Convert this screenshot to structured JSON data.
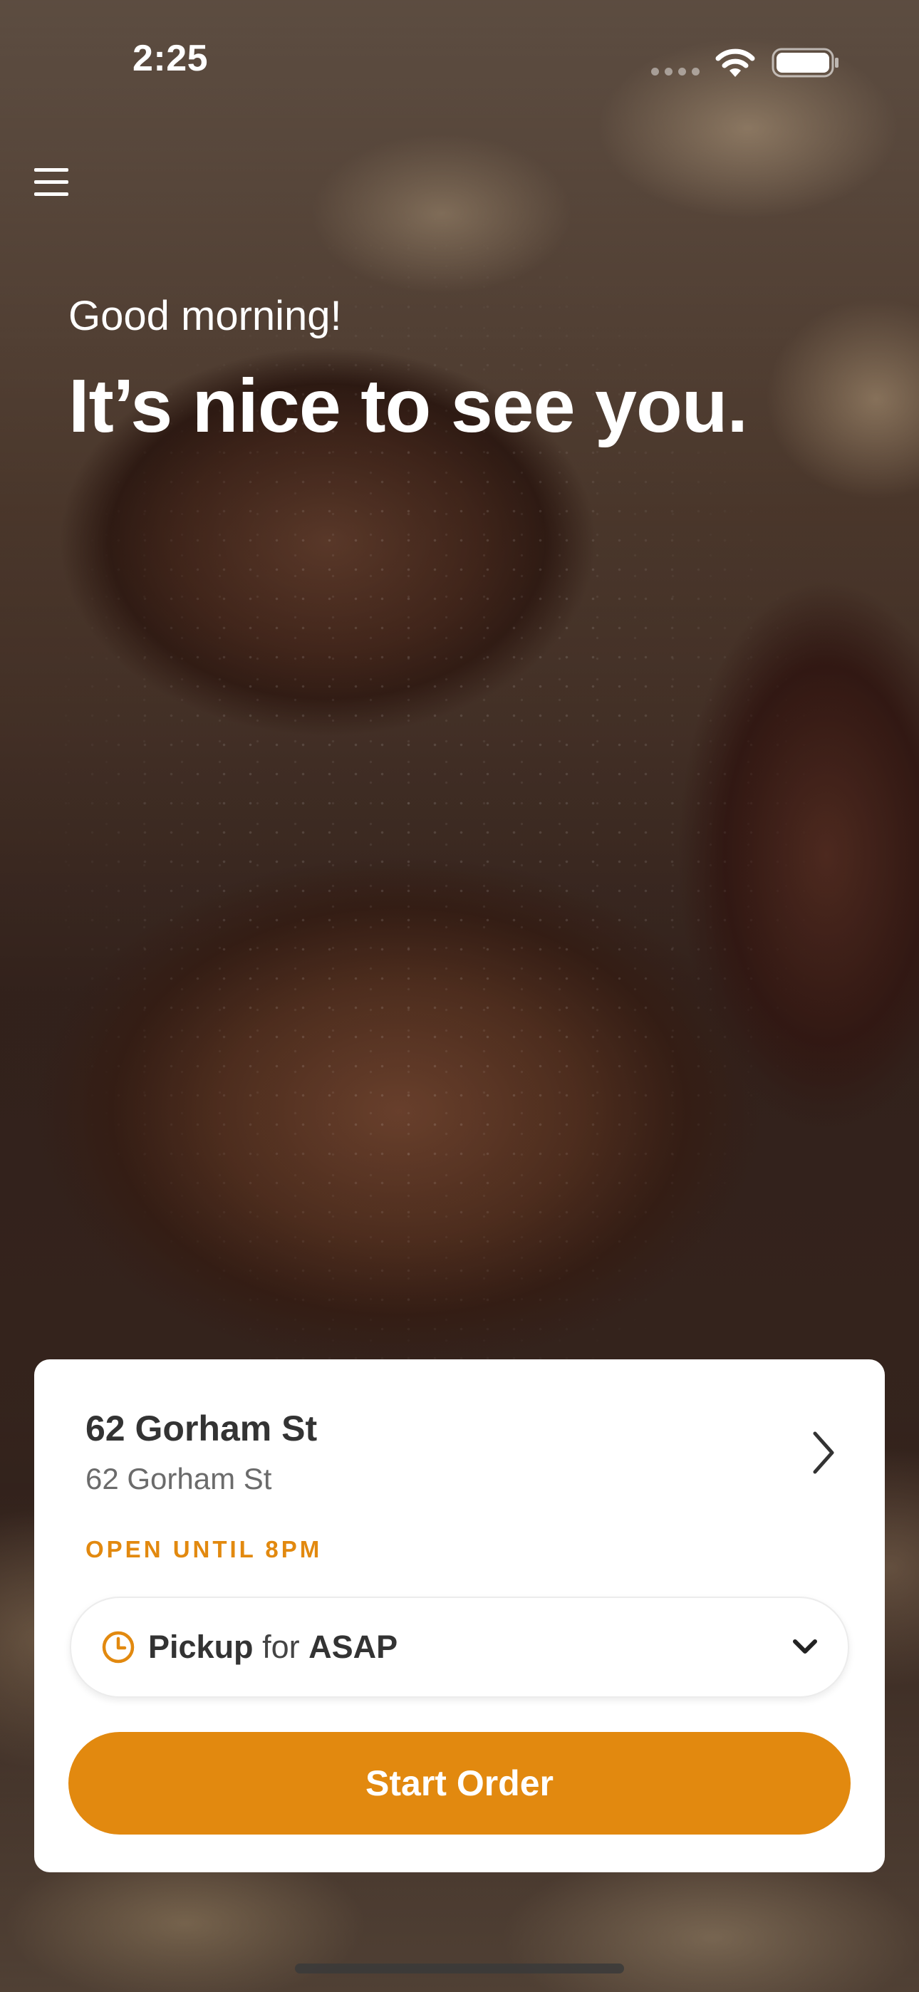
{
  "status_bar": {
    "time": "2:25"
  },
  "greeting": {
    "salutation": "Good morning!",
    "headline": "It’s nice to see you."
  },
  "location": {
    "name": "62 Gorham St",
    "address": "62 Gorham St",
    "hours": "OPEN UNTIL 8PM"
  },
  "order_mode": {
    "type": "Pickup",
    "connector": "for",
    "time": "ASAP"
  },
  "start_button": {
    "label": "Start Order"
  },
  "colors": {
    "accent": "#e2890f",
    "card_background": "#ffffff",
    "text_primary": "#333333",
    "text_secondary": "#6b6b6b"
  },
  "icons": {
    "menu": "hamburger-menu-icon",
    "location_chevron": "chevron-right-icon",
    "clock": "clock-icon",
    "dropdown": "chevron-down-icon",
    "wifi": "wifi-icon",
    "battery": "battery-icon"
  }
}
